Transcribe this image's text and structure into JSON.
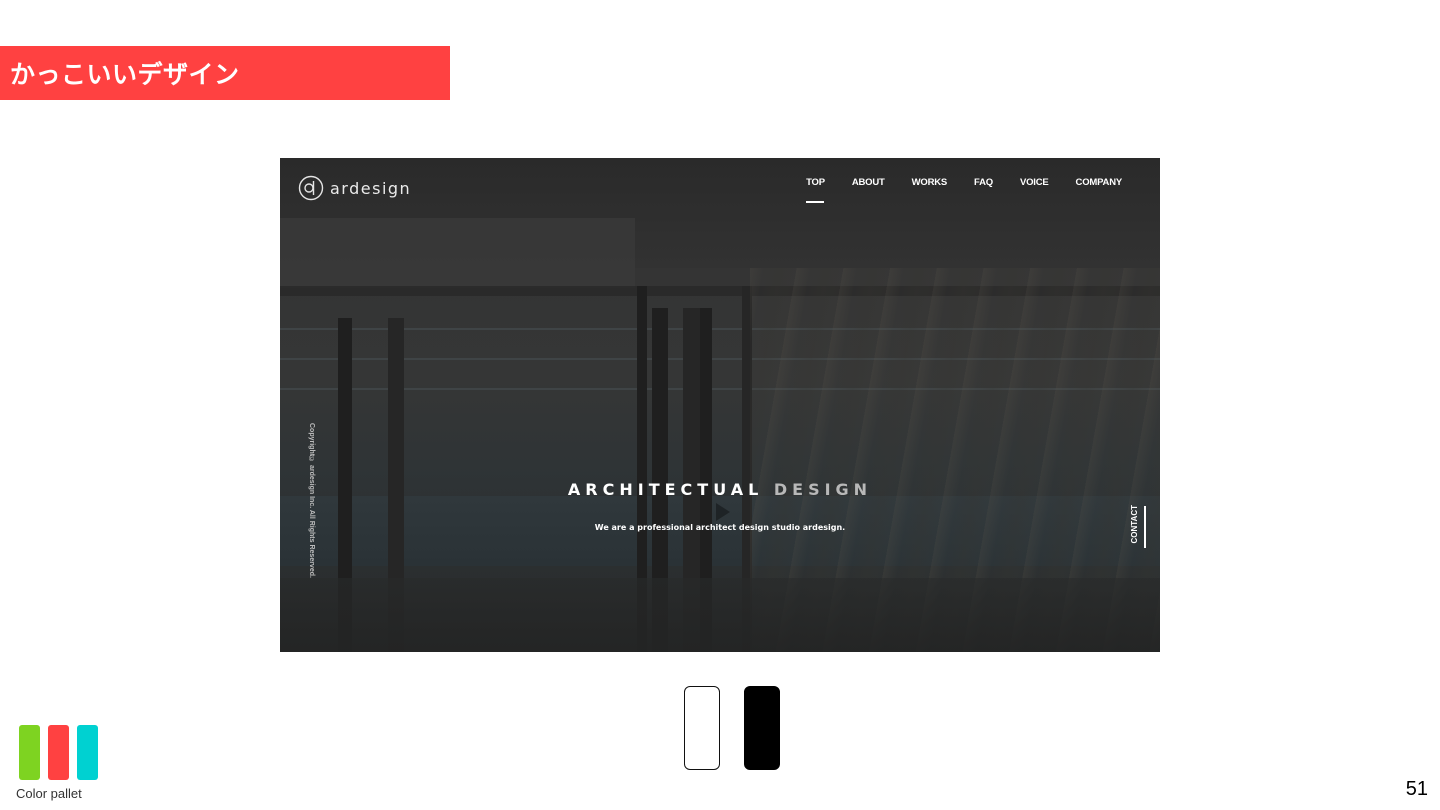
{
  "slide": {
    "title": "かっこいいデザイン",
    "page_number": "51",
    "accent_color": "#ff4141"
  },
  "website": {
    "logo": {
      "text": "ardesign",
      "icon": "ardesign-logo-icon"
    },
    "nav": [
      "TOP",
      "ABOUT",
      "WORKS",
      "FAQ",
      "VOICE",
      "COMPANY"
    ],
    "active_nav": "TOP",
    "hero": {
      "title_word_1": "ARCHITECTUAL",
      "title_word_2": "DESIGN",
      "subtitle": "We are a professional architect design studio ardesign."
    },
    "copyright": "Copyright© ardesign Inc. All Rights Reserved.",
    "contact": "CONTACT"
  },
  "design_colors": [
    "#ffffff",
    "#000000"
  ],
  "color_pallet": {
    "label": "Color pallet",
    "colors": [
      "#7ed321",
      "#ff4141",
      "#00d1d1"
    ]
  }
}
